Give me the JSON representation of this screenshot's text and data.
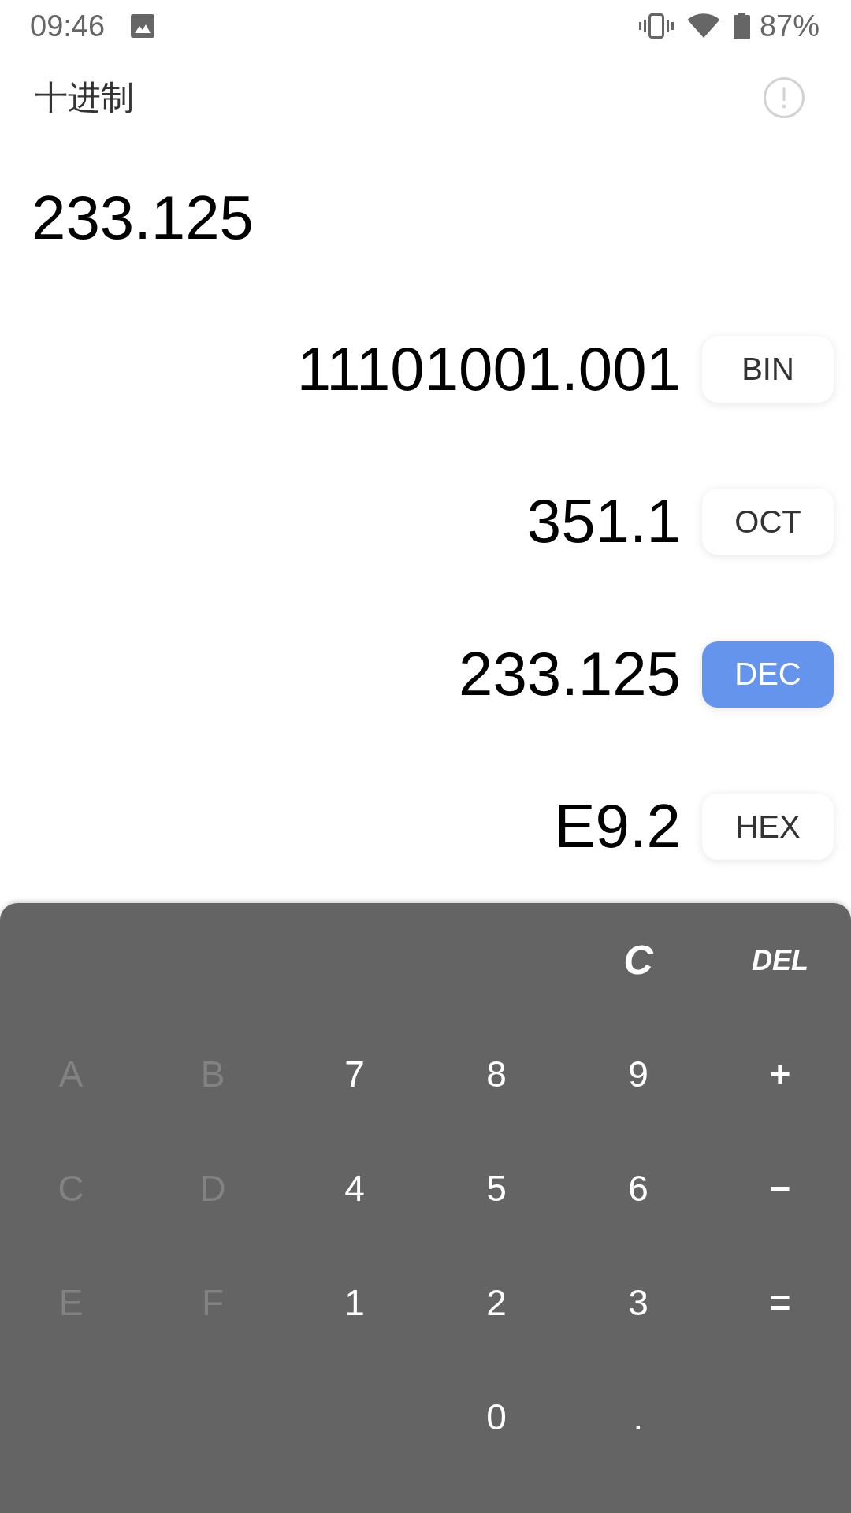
{
  "status_bar": {
    "time": "09:46",
    "battery": "87%"
  },
  "header": {
    "title": "十进制"
  },
  "input_value": "233.125",
  "conversions": [
    {
      "value": "11101001.001",
      "base": "BIN",
      "selected": false
    },
    {
      "value": "351.1",
      "base": "OCT",
      "selected": false
    },
    {
      "value": "233.125",
      "base": "DEC",
      "selected": true
    },
    {
      "value": "E9.2",
      "base": "HEX",
      "selected": false
    }
  ],
  "keypad": {
    "top_keys": [
      {
        "label": "C",
        "kind": "clear"
      },
      {
        "label": "DEL",
        "kind": "delete"
      }
    ],
    "hex_keys": [
      {
        "label": "A",
        "disabled": true
      },
      {
        "label": "B",
        "disabled": true
      },
      {
        "label": "C",
        "disabled": true
      },
      {
        "label": "D",
        "disabled": true
      },
      {
        "label": "E",
        "disabled": true
      },
      {
        "label": "F",
        "disabled": true
      }
    ],
    "number_keys": [
      {
        "label": "7",
        "disabled": false
      },
      {
        "label": "8",
        "disabled": false
      },
      {
        "label": "9",
        "disabled": false
      },
      {
        "label": "4",
        "disabled": false
      },
      {
        "label": "5",
        "disabled": false
      },
      {
        "label": "6",
        "disabled": false
      },
      {
        "label": "1",
        "disabled": false
      },
      {
        "label": "2",
        "disabled": false
      },
      {
        "label": "3",
        "disabled": false
      },
      {
        "label": "0",
        "disabled": false
      },
      {
        "label": ".",
        "disabled": false
      }
    ],
    "operator_keys": [
      {
        "label": "+",
        "disabled": false
      },
      {
        "label": "−",
        "disabled": false
      },
      {
        "label": "=",
        "disabled": false
      }
    ]
  }
}
